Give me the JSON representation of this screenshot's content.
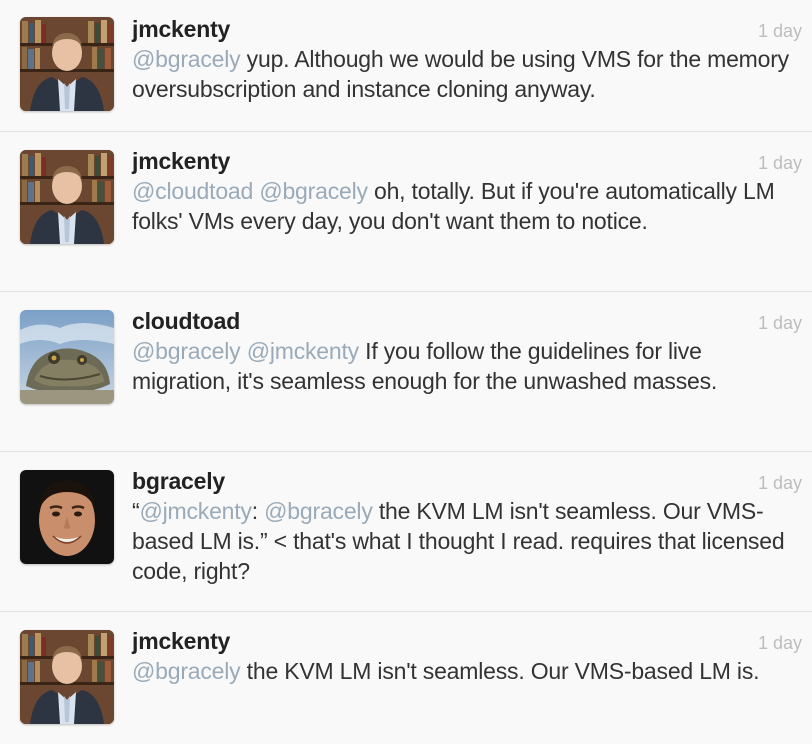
{
  "tweets": [
    {
      "username": "jmckenty",
      "time": "1 day",
      "avatar_icon": "bookshelf-man-avatar",
      "segments": [
        {
          "type": "mention",
          "text": "@bgracely"
        },
        {
          "type": "text",
          "text": " yup. Although we would be using VMS for the memory oversubscription and instance cloning anyway."
        }
      ]
    },
    {
      "username": "jmckenty",
      "time": "1 day",
      "avatar_icon": "bookshelf-man-avatar",
      "segments": [
        {
          "type": "mention",
          "text": "@cloudtoad"
        },
        {
          "type": "text",
          "text": " "
        },
        {
          "type": "mention",
          "text": "@bgracely"
        },
        {
          "type": "text",
          "text": " oh, totally. But if you're automatically LM folks' VMs every day, you don't want them to notice."
        }
      ]
    },
    {
      "username": "cloudtoad",
      "time": "1 day",
      "avatar_icon": "toad-avatar",
      "segments": [
        {
          "type": "mention",
          "text": "@bgracely"
        },
        {
          "type": "text",
          "text": " "
        },
        {
          "type": "mention",
          "text": "@jmckenty"
        },
        {
          "type": "text",
          "text": " If you follow the guidelines for live migration, it's seamless enough for the unwashed masses."
        }
      ]
    },
    {
      "username": "bgracely",
      "time": "1 day",
      "avatar_icon": "smiling-man-avatar",
      "segments": [
        {
          "type": "text",
          "text": "“"
        },
        {
          "type": "mention",
          "text": "@jmckenty"
        },
        {
          "type": "text",
          "text": ": "
        },
        {
          "type": "mention",
          "text": "@bgracely"
        },
        {
          "type": "text",
          "text": " the KVM LM isn't seamless. Our VMS-based LM is.” < that's what I thought I read. requires that licensed code, right?"
        }
      ]
    },
    {
      "username": "jmckenty",
      "time": "1 day",
      "avatar_icon": "bookshelf-man-avatar",
      "segments": [
        {
          "type": "mention",
          "text": "@bgracely"
        },
        {
          "type": "text",
          "text": " the KVM LM isn't seamless. Our VMS-based LM is."
        }
      ]
    }
  ],
  "colors": {
    "mention": "#9aaab8",
    "username": "#222222",
    "body_text": "#333333",
    "timestamp": "#bdbdbd",
    "background": "#f9f9f9"
  }
}
